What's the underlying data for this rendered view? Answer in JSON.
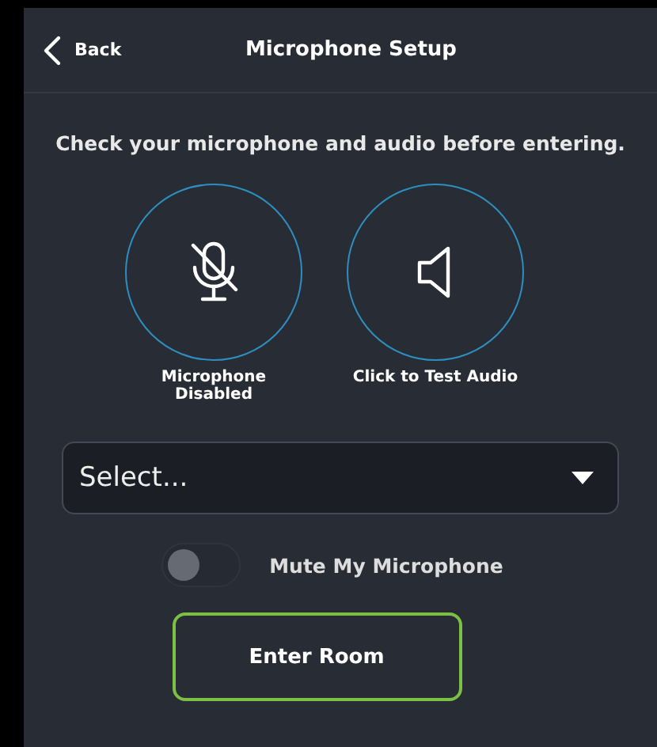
{
  "header": {
    "back_label": "Back",
    "title": "Microphone Setup"
  },
  "instructions": "Check your microphone and audio before entering.",
  "devices": [
    {
      "kind": "microphone",
      "label": "Microphone Disabled",
      "disabled": true
    },
    {
      "kind": "speaker",
      "label": "Click to Test Audio",
      "disabled": false
    }
  ],
  "device_select": {
    "placeholder": "Select..."
  },
  "mute_toggle": {
    "label": "Mute My Microphone",
    "on": false
  },
  "enter_button": {
    "label": "Enter Room"
  }
}
